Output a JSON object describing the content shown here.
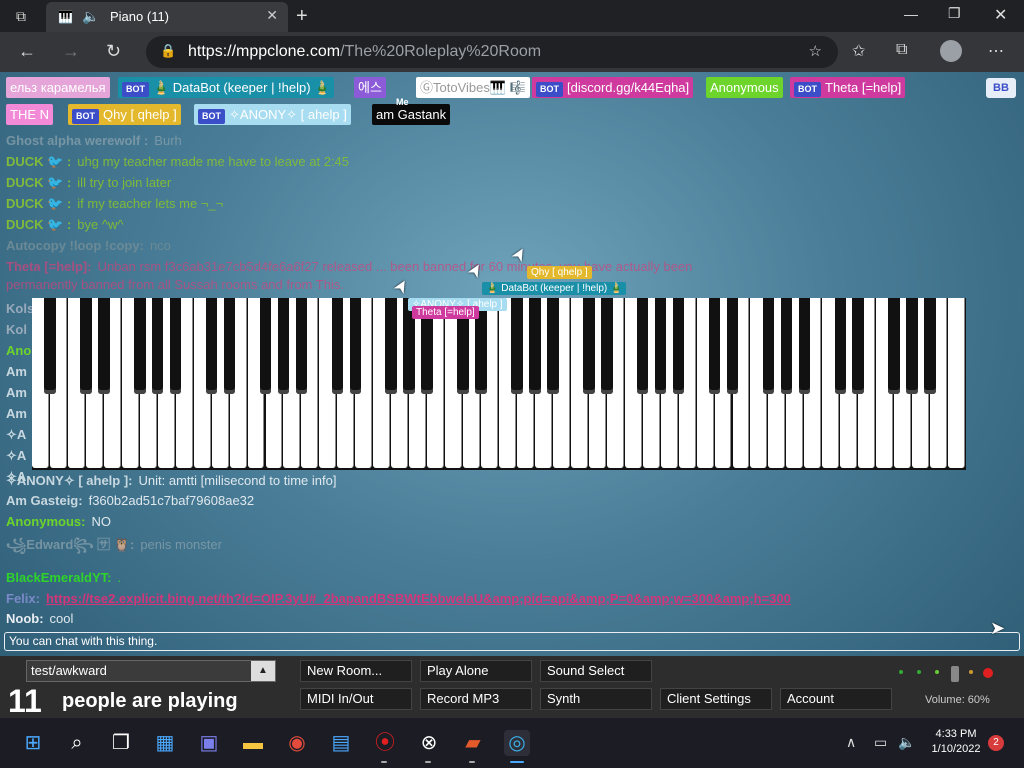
{
  "browser": {
    "tab_title": "Piano (11)",
    "url_host": "https://mppclone.com",
    "url_path": "/The%20Roleplay%20Room"
  },
  "userbar": {
    "users": [
      {
        "label": "ельз карамелья",
        "bg": "#e6a5d8",
        "color": "#fff",
        "bot": false
      },
      {
        "label": "🎍 DataBot (keeper | !help) 🎍",
        "bg": "#1a8fa8",
        "color": "#fff",
        "bot": true
      },
      {
        "label": "에스",
        "bg": "#8c5cd8",
        "color": "#fff",
        "bot": false
      },
      {
        "label": "ⒼTotoVibes🎹 🎼",
        "bg": "#ffffff",
        "color": "#999",
        "bot": false
      },
      {
        "label": "[discord.gg/k44Eqha]",
        "bg": "#cf3a9e",
        "color": "#fff",
        "bot": true
      },
      {
        "label": "Anonymous",
        "bg": "#6cd42a",
        "color": "#fff",
        "bot": false
      },
      {
        "label": "Theta [=help]",
        "bg": "#cf3a9e",
        "color": "#fff",
        "bot": true
      },
      {
        "label": "THE N",
        "bg": "#f28ad8",
        "color": "#fff",
        "bot": false
      },
      {
        "label": "Qhy [ qhelp ]",
        "bg": "#e3b82c",
        "color": "#fff",
        "bot": true
      },
      {
        "label": "✧ANONY✧ [ ahelp ]",
        "bg": "#a8dcf0",
        "color": "#fff",
        "bot": true
      },
      {
        "label": "am Gastank",
        "bg": "#0a0a0a",
        "color": "#fff",
        "bot": false
      }
    ],
    "bot_tag": "BOT",
    "bb_label": "BB",
    "me_label": "Me"
  },
  "chat": {
    "messages": [
      {
        "name": "Ghost alpha werewolf :",
        "text": "Burh",
        "color": "#8aa2ad"
      },
      {
        "name": "DUCK 🐦 :",
        "text": "uhg my teacher made me have to leave at 2:45",
        "color": "#7fba3a"
      },
      {
        "name": "DUCK 🐦 :",
        "text": "ill try to join later",
        "color": "#7fba3a"
      },
      {
        "name": "DUCK 🐦 :",
        "text": "if my teacher lets me ¬_¬",
        "color": "#7fba3a"
      },
      {
        "name": "DUCK 🐦 :",
        "text": "bye ^w^",
        "color": "#7fba3a"
      },
      {
        "name": "Autocopy !loop !copy:",
        "text": "nco",
        "color": "#6b8a96"
      },
      {
        "name": "Theta [=help]:",
        "text": "Unban rsm f3c6ab31e7cb5d4fe6a6f27 released ... been banned for 60 minutes. you have actually been",
        "color": "#c8467e"
      },
      {
        "name": "",
        "text": "permanently banned from all Sussah rooms and from This.",
        "color": "#c8467e"
      },
      {
        "name": "✧ANONY✧ [ ahelp ]:",
        "text": "Unit: amtti [milisecond to time info]",
        "color": "#c8d8e0"
      },
      {
        "name": "Am Gasteig:",
        "text": "f360b2ad51c7baf79608ae32",
        "color": "#c8d8e0"
      },
      {
        "name": "Anonymous:",
        "text": "NO",
        "color": "#6cd42a"
      },
      {
        "name": "꧁Edward꧂ 🈂 🦉:",
        "text": "penis monster",
        "color": "#8aa2ad"
      },
      {
        "name": "BlackEmeraldYT:",
        "text": ".",
        "color": "#2ed42a"
      },
      {
        "name": "Felix:",
        "text": "https://tse2.explicit.bing.net/th?id=OIP.3yU#_2bapandBSBWtEbbwelaU&amp;pid=api&amp;P=0&amp;w=300&amp;h=300",
        "color": "#7a8ac8",
        "is_link": true
      },
      {
        "name": "Noob:",
        "text": "cool",
        "color": "#e8eef4"
      }
    ],
    "partial_names": [
      "Kolshi",
      "Kol",
      "Ano",
      "Am",
      "Am",
      "Am",
      "✧A",
      "✧A",
      "✧A"
    ],
    "input_placeholder": "You can chat with this thing."
  },
  "cursors": [
    {
      "label": "Qhy [ qhelp ]",
      "bg": "#e3b82c"
    },
    {
      "label": "🎍 DataBot (keeper | !help) 🎍",
      "bg": "#1a8fa8"
    },
    {
      "label": "✧ANONY✧ [ ahelp ]",
      "bg": "#a8dcf0"
    },
    {
      "label": "Theta [=help]",
      "bg": "#cf3a9e"
    }
  ],
  "bottom": {
    "room_name": "test/awkward",
    "people_count": "11",
    "people_label": "people are playing",
    "buttons": {
      "new_room": "New Room...",
      "play_alone": "Play Alone",
      "sound_select": "Sound Select",
      "midi": "MIDI In/Out",
      "record": "Record MP3",
      "synth": "Synth",
      "client_settings": "Client Settings",
      "account": "Account"
    },
    "volume": "Volume: 60%"
  },
  "taskbar": {
    "time": "4:33 PM",
    "date": "1/10/2022",
    "notifications": "2"
  }
}
